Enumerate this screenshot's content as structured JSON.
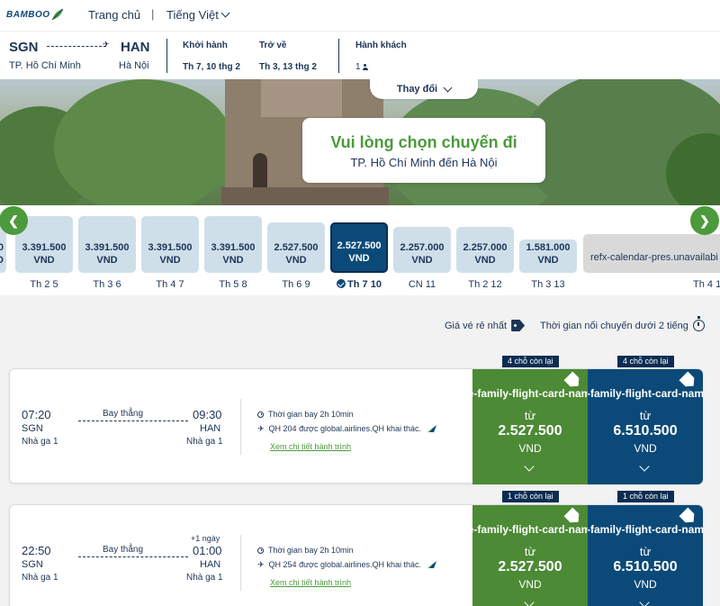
{
  "nav": {
    "logo_text": "BAMBOO",
    "home": "Trang chủ",
    "separator": "|",
    "language": "Tiếng Việt"
  },
  "itinerary": {
    "origin_code": "SGN",
    "origin_city": "TP. Hồ Chí Minh",
    "destination_code": "HAN",
    "destination_city": "Hà Nội",
    "departure_label": "Khởi hành",
    "departure_value": "Th 7, 10 thg 2",
    "return_label": "Trở về",
    "return_value": "Th 3, 13 thg 2",
    "passengers_label": "Hành khách",
    "passengers_value": "1"
  },
  "hero": {
    "title": "Vui lòng chọn chuyến đi",
    "subtitle": "TP. Hồ Chí Minh đến Hà Nội",
    "change_label": "Thay đổi"
  },
  "calendar": {
    "prev_icon": "chevron-left-icon",
    "next_icon": "chevron-right-icon",
    "days": [
      {
        "label": "Th 2 5",
        "price": "3.391.500",
        "currency": "VND",
        "level": 0.62
      },
      {
        "label": "Th 3 6",
        "price": "3.391.500",
        "currency": "VND",
        "level": 0.62
      },
      {
        "label": "Th 4 7",
        "price": "3.391.500",
        "currency": "VND",
        "level": 0.62
      },
      {
        "label": "Th 5 8",
        "price": "3.391.500",
        "currency": "VND",
        "level": 0.62
      },
      {
        "label": "Th 6 9",
        "price": "2.527.500",
        "currency": "VND",
        "level": 0.55
      },
      {
        "label": "Th 7 10",
        "price": "2.527.500",
        "currency": "VND",
        "level": 0.55,
        "selected": true
      },
      {
        "label": "CN 11",
        "price": "2.257.000",
        "currency": "VND",
        "level": 0.5
      },
      {
        "label": "Th 2 12",
        "price": "2.257.000",
        "currency": "VND",
        "level": 0.5
      },
      {
        "label": "Th 3 13",
        "price": "1.581.000",
        "currency": "VND",
        "level": 0.36
      }
    ],
    "first_partial_price": "0",
    "first_partial_currency": "D",
    "unavailable_text": "refx-calendar-pres.unavailabi",
    "last_label": "Th 4 1"
  },
  "filters": {
    "cheapest": "Giá vé rẻ nhất",
    "connection": "Thời gian nối chuyến dưới 2 tiếng"
  },
  "flights": [
    {
      "dep_time": "07:20",
      "arr_time": "09:30",
      "dep_code": "SGN",
      "arr_code": "HAN",
      "dep_terminal": "Nhà ga 1",
      "arr_terminal": "Nhà ga 1",
      "mode": "Bay thẳng",
      "plus_day": "",
      "duration": "Thời gian bay  2h 10min",
      "operator": "QH 204 được global.airlines.QH khai thác.",
      "details_link": "Xem chi tiết hành trình",
      "fares": [
        {
          "family": "re-family-flight-card-name",
          "seats": "4 chỗ còn lại",
          "from": "từ",
          "price": "2.527.500",
          "currency": "VND"
        },
        {
          "family": "e-family-flight-card-name",
          "seats": "4 chỗ còn lại",
          "from": "từ",
          "price": "6.510.500",
          "currency": "VND"
        }
      ]
    },
    {
      "dep_time": "22:50",
      "arr_time": "01:00",
      "dep_code": "SGN",
      "arr_code": "HAN",
      "dep_terminal": "Nhà ga 1",
      "arr_terminal": "Nhà ga 1",
      "mode": "Bay thẳng",
      "plus_day": "+1 ngày",
      "duration": "Thời gian bay  2h 10min",
      "operator": "QH 254 được global.airlines.QH khai thác.",
      "details_link": "Xem chi tiết hành trình",
      "fares": [
        {
          "family": "re-family-flight-card-name",
          "seats": "1 chỗ còn lại",
          "from": "từ",
          "price": "2.527.500",
          "currency": "VND"
        },
        {
          "family": "e-family-flight-card-name",
          "seats": "1 chỗ còn lại",
          "from": "từ",
          "price": "6.510.500",
          "currency": "VND"
        }
      ]
    }
  ],
  "colors": {
    "navy": "#1c3557",
    "brand_blue": "#0b4a78",
    "brand_green": "#4c9a3c",
    "economy_fare": "#4c8a35",
    "calendar_bar": "#cfdfea"
  }
}
